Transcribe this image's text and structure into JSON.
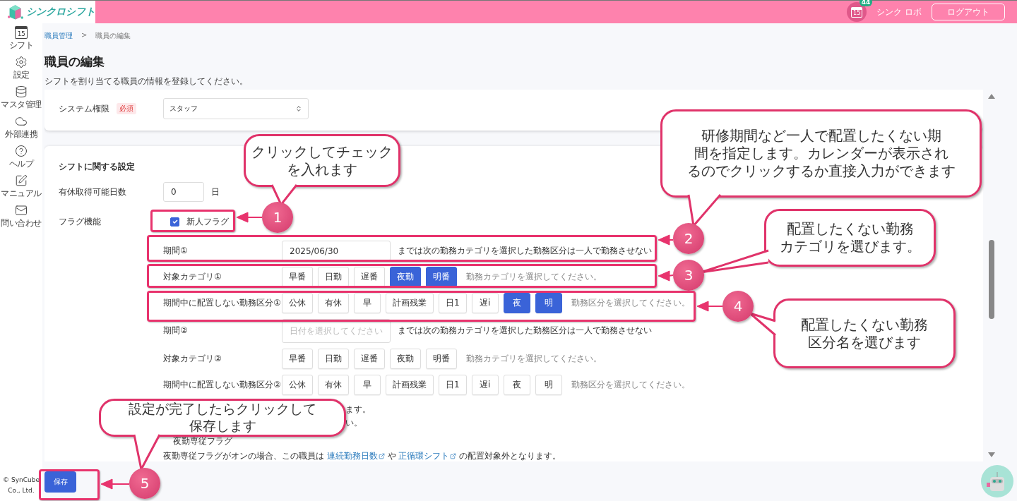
{
  "header": {
    "logo_text": "シンクロシフト",
    "calendar_day": "15",
    "notification_count": "44",
    "user": "シンク ロボ",
    "logout": "ログアウト"
  },
  "sidebar": {
    "items": [
      {
        "kind": "calendar",
        "icon_text": "15",
        "label": "シフト"
      },
      {
        "kind": "gear",
        "label": "設定"
      },
      {
        "kind": "database",
        "label": "マスタ管理"
      },
      {
        "kind": "cloud",
        "label": "外部連携"
      },
      {
        "kind": "help",
        "label": "ヘルプ"
      },
      {
        "kind": "edit",
        "label": "マニュアル"
      },
      {
        "kind": "mail",
        "label": "問い合わせ"
      }
    ],
    "copyright": "© SynCube Co., Ltd."
  },
  "breadcrumb": {
    "items": [
      {
        "label": "職員管理",
        "link": true
      },
      {
        "label": "職員の編集",
        "link": false
      }
    ],
    "separator": ">"
  },
  "page": {
    "title": "職員の編集",
    "description": "シフトを割り当てる職員の情報を登録してください。"
  },
  "system_card": {
    "label": "システム権限",
    "required": "必須",
    "value": "スタッフ"
  },
  "shift_card": {
    "title": "シフトに関する設定",
    "rows": [
      {
        "kind": "number",
        "label": "有休取得可能日数",
        "value": "0",
        "unit": "日"
      },
      {
        "kind": "checkbox",
        "label": "フラグ機能",
        "option": "新人フラグ",
        "checked": true
      }
    ],
    "sub_rows": [
      {
        "kind": "date",
        "label": "期間①",
        "value": "2025/06/30",
        "note": "までは次の勤務カテゴリを選択した勤務区分は一人で勤務させない"
      },
      {
        "kind": "chips",
        "label": "対象カテゴリ①",
        "hint": "勤務カテゴリを選択してください。",
        "chips": [
          {
            "label": "早番",
            "selected": false
          },
          {
            "label": "日勤",
            "selected": false
          },
          {
            "label": "遅番",
            "selected": false
          },
          {
            "label": "夜勤",
            "selected": true
          },
          {
            "label": "明番",
            "selected": true
          }
        ]
      },
      {
        "kind": "chips",
        "label": "期間中に配置しない勤務区分①",
        "hint": "勤務区分を選択してください。",
        "chips": [
          {
            "label": "公休",
            "selected": false
          },
          {
            "label": "有休",
            "selected": false
          },
          {
            "label": "早",
            "selected": false
          },
          {
            "label": "計画残業",
            "selected": false
          },
          {
            "label": "日1",
            "selected": false
          },
          {
            "label": "遅i",
            "selected": false
          },
          {
            "label": "夜",
            "selected": true
          },
          {
            "label": "明",
            "selected": true
          }
        ]
      },
      {
        "kind": "date",
        "label": "期間②",
        "placeholder": "日付を選択してください",
        "note": "までは次の勤務カテゴリを選択した勤務区分は一人で勤務させない"
      },
      {
        "kind": "chips",
        "label": "対象カテゴリ②",
        "hint": "勤務カテゴリを選択してください。",
        "chips": [
          {
            "label": "早番",
            "selected": false
          },
          {
            "label": "日勤",
            "selected": false
          },
          {
            "label": "遅番",
            "selected": false
          },
          {
            "label": "夜勤",
            "selected": false
          },
          {
            "label": "明番",
            "selected": false
          }
        ]
      },
      {
        "kind": "chips",
        "label": "期間中に配置しない勤務区分②",
        "hint": "勤務区分を選択してください。",
        "chips": [
          {
            "label": "公休",
            "selected": false
          },
          {
            "label": "有休",
            "selected": false
          },
          {
            "label": "早",
            "selected": false
          },
          {
            "label": "計画残業",
            "selected": false
          },
          {
            "label": "日1",
            "selected": false
          },
          {
            "label": "遅i",
            "selected": false
          },
          {
            "label": "夜",
            "selected": false
          },
          {
            "label": "明",
            "selected": false
          }
        ]
      }
    ],
    "notes": [
      "ます。",
      "い。"
    ],
    "night_flag": {
      "label": "夜勤専従フラグ",
      "text_1": "夜勤専従フラグがオンの場合、この職員は",
      "link_1": "連続勤務日数",
      "text_2": "や",
      "link_2": "正循環シフト",
      "text_3": "の配置対象外となります。"
    }
  },
  "footer": {
    "save": "保存"
  },
  "annotations": [
    {
      "number": "1",
      "lines": [
        "クリックしてチェック",
        "を入れます"
      ]
    },
    {
      "number": "2",
      "lines": [
        "研修期間など一人で配置したくない期",
        "間を指定します。カレンダーが表示され",
        "るのでクリックするか直接入力ができます"
      ]
    },
    {
      "number": "3",
      "lines": [
        "配置したくない勤務",
        "カテゴリを選びます。"
      ]
    },
    {
      "number": "4",
      "lines": [
        "配置したくない勤務",
        "区分名を選びます"
      ]
    },
    {
      "number": "5",
      "lines": [
        "設定が完了したらクリックして",
        "保存します"
      ]
    }
  ]
}
